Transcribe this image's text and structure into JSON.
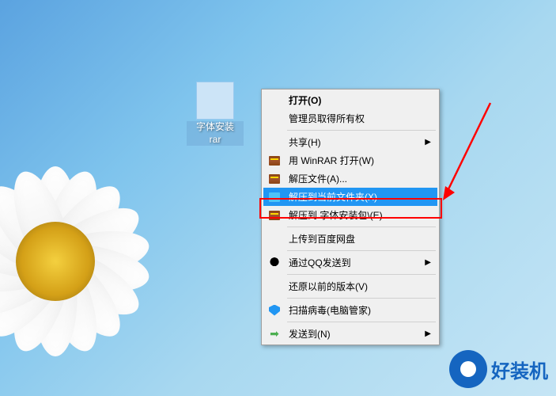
{
  "file": {
    "name": "字体安装\nrar"
  },
  "menu": {
    "items": [
      {
        "label": "打开(O)",
        "icon": null,
        "highlighted": false,
        "submenu": false,
        "bold": true
      },
      {
        "label": "管理员取得所有权",
        "icon": null,
        "highlighted": false,
        "submenu": false
      },
      {
        "separator": true
      },
      {
        "label": "共享(H)",
        "icon": null,
        "highlighted": false,
        "submenu": true
      },
      {
        "label": "用 WinRAR 打开(W)",
        "icon": "winrar",
        "highlighted": false,
        "submenu": false
      },
      {
        "label": "解压文件(A)...",
        "icon": "winrar",
        "highlighted": false,
        "submenu": false
      },
      {
        "label": "解压到当前文件夹(X)",
        "icon": "rar-blue",
        "highlighted": true,
        "submenu": false
      },
      {
        "label": "解压到 字体安装包\\(E)",
        "icon": "winrar",
        "highlighted": false,
        "submenu": false
      },
      {
        "separator": true
      },
      {
        "label": "上传到百度网盘",
        "icon": null,
        "highlighted": false,
        "submenu": false
      },
      {
        "separator": true
      },
      {
        "label": "通过QQ发送到",
        "icon": "qq",
        "highlighted": false,
        "submenu": true
      },
      {
        "separator": true
      },
      {
        "label": "还原以前的版本(V)",
        "icon": null,
        "highlighted": false,
        "submenu": false
      },
      {
        "separator": true
      },
      {
        "label": "扫描病毒(电脑管家)",
        "icon": "shield",
        "highlighted": false,
        "submenu": false
      },
      {
        "separator": true
      },
      {
        "label": "发送到(N)",
        "icon": "send",
        "highlighted": false,
        "submenu": true
      }
    ]
  },
  "watermark": {
    "text": "好装机"
  }
}
